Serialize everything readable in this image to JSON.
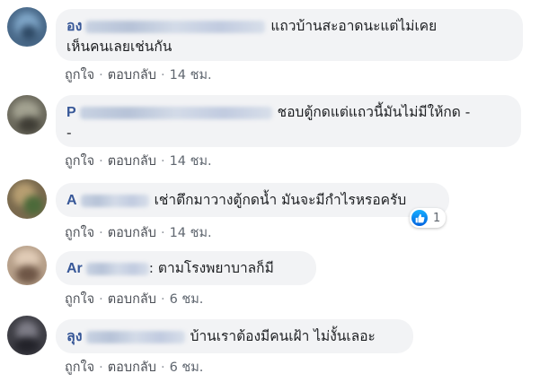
{
  "comments": [
    {
      "name_visible": "อง",
      "text": "แถวบ้านสะอาดนะแต่ไม่เคยเห็นคนเลยเช่นกัน",
      "text_line1": "แถวบ้านสะอาดนะแต่ไม่เคย",
      "text_line2": "เห็นคนเลยเช่นกัน",
      "like": "ถูกใจ",
      "reply": "ตอบกลับ",
      "time": "14 ชม."
    },
    {
      "name_visible": "P",
      "text_line1": "ชอบตู้กดแต่แถวนี้มันไม่มีให้กด -",
      "text_line2": "-",
      "like": "ถูกใจ",
      "reply": "ตอบกลับ",
      "time": "14 ชม."
    },
    {
      "name_visible": "A",
      "text": "เช่าตึกมาวางตู้กดน้ำ มันจะมีกำไรหรอครับ",
      "like": "ถูกใจ",
      "reply": "ตอบกลับ",
      "time": "14 ชม.",
      "reaction_count": "1"
    },
    {
      "name_visible": "Ar",
      "text": ": ตามโรงพยาบาลก็มี",
      "like": "ถูกใจ",
      "reply": "ตอบกลับ",
      "time": "6 ชม."
    },
    {
      "name_visible": "ลุง",
      "text": "บ้านเราต้องมีคนเฝ้า ไม่งั้นเลอะ",
      "like": "ถูกใจ",
      "reply": "ตอบกลับ",
      "time": "6 ชม."
    }
  ],
  "separator": "·",
  "colors": {
    "name": "#385898",
    "bubble": "#f2f3f5",
    "meta": "#606770",
    "like_icon": "#1877f2"
  },
  "icons": [
    "avatar",
    "like-reaction-icon"
  ]
}
